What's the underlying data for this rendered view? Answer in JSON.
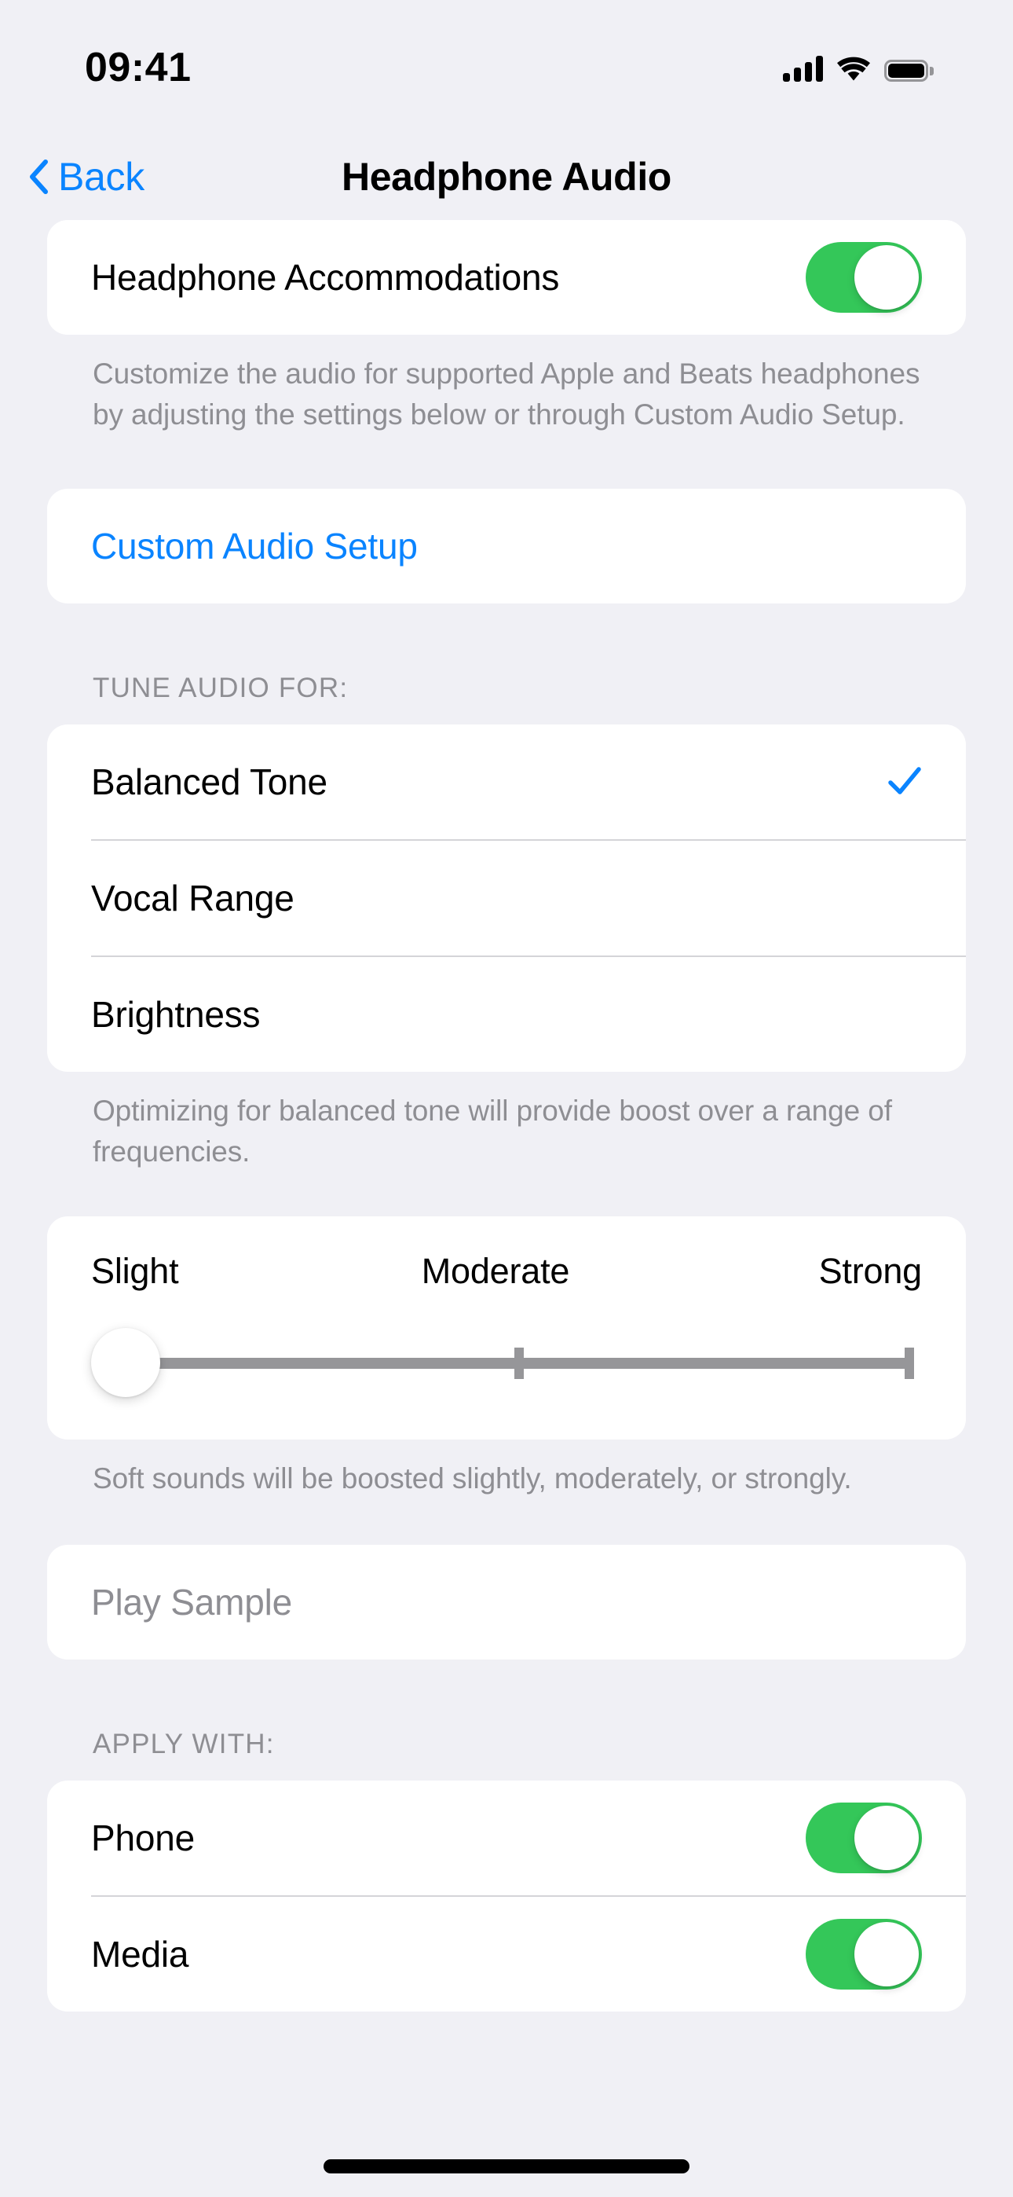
{
  "status_bar": {
    "time": "09:41",
    "cellular_icon": "cellular-signal-icon",
    "wifi_icon": "wifi-icon",
    "battery_icon": "battery-full-icon"
  },
  "nav": {
    "back_icon": "chevron-left-icon",
    "back_label": "Back",
    "title": "Headphone Audio"
  },
  "accommodations": {
    "label": "Headphone Accommodations",
    "toggle_state": "on",
    "footnote": "Customize the audio for supported Apple and Beats headphones by adjusting the settings below or through Custom Audio Setup."
  },
  "custom_setup": {
    "label": "Custom Audio Setup"
  },
  "tune_audio": {
    "header": "TUNE AUDIO FOR:",
    "options": [
      {
        "label": "Balanced Tone",
        "selected": true
      },
      {
        "label": "Vocal Range",
        "selected": false
      },
      {
        "label": "Brightness",
        "selected": false
      }
    ],
    "selected_check_icon": "checkmark-icon",
    "footnote": "Optimizing for balanced tone will provide boost over a range of frequencies."
  },
  "strength_slider": {
    "label_min": "Slight",
    "label_mid": "Moderate",
    "label_max": "Strong",
    "value": "Slight",
    "value_index": 0,
    "steps": 3,
    "footnote": "Soft sounds will be boosted slightly, moderately, or strongly."
  },
  "play_sample": {
    "label": "Play Sample",
    "enabled": false
  },
  "apply_with": {
    "header": "APPLY WITH:",
    "items": [
      {
        "label": "Phone",
        "toggle_state": "on"
      },
      {
        "label": "Media",
        "toggle_state": "on"
      }
    ]
  },
  "colors": {
    "background": "#F0F0F5",
    "card": "#FFFFFF",
    "accent_blue": "#0A84FF",
    "toggle_on_green": "#34C759",
    "secondary_text": "#8E8E93",
    "slider_track": "#969699",
    "separator": "#D4D4D8"
  },
  "home_indicator": "home-indicator"
}
